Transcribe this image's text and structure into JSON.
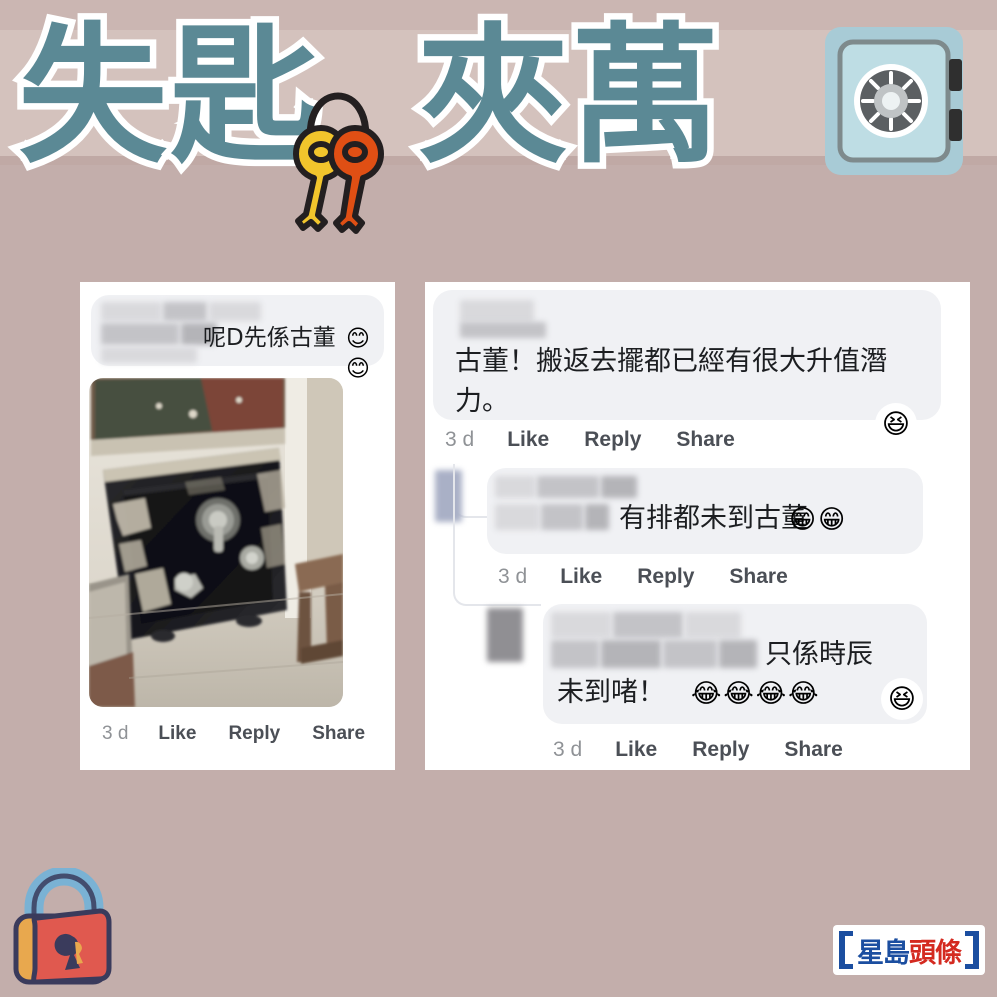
{
  "poster": {
    "headline_text": "失匙夾萬",
    "headline_char_1": "失",
    "headline_char_2": "匙",
    "headline_char_3": "夾",
    "headline_char_4": "萬",
    "headline_color": "#5b8995",
    "headline_outline_color": "#ffffff",
    "background_color": "#c3aeab",
    "wall_color": "#d4c2bd",
    "icons": {
      "keys": "keys-icon",
      "safe": "safe-icon",
      "padlock": "padlock-icon"
    }
  },
  "logo": {
    "name": "sing-tao-headline-logo",
    "text_blue": "星島",
    "text_red": "頭條",
    "blue": "#1b4ea0",
    "red": "#d42a20"
  },
  "screenshot_left": {
    "comment": {
      "text": "呢D先係古董",
      "emojis": "😊😊",
      "author_redacted": true
    },
    "photo_alt": "old black antique safe with peeling paint",
    "actions": {
      "time": "3 d",
      "like": "Like",
      "reply": "Reply",
      "share": "Share"
    }
  },
  "screenshot_right": {
    "comments": [
      {
        "level": 0,
        "text": "古董！搬返去擺都已經有很大升值潛力。",
        "emojis": "",
        "reaction": "😆",
        "author_redacted": true,
        "actions": {
          "time": "3 d",
          "like": "Like",
          "reply": "Reply",
          "share": "Share"
        }
      },
      {
        "level": 1,
        "text": "有排都未到古董",
        "emojis": "😁😁",
        "reaction": "",
        "author_redacted": true,
        "actions": {
          "time": "3 d",
          "like": "Like",
          "reply": "Reply",
          "share": "Share"
        }
      },
      {
        "level": 2,
        "text_line1": "只係時辰",
        "text_line2": "未到啫！",
        "emojis": "😂😂😂😂",
        "reaction": "😆",
        "author_redacted": true,
        "actions": {
          "time": "3 d",
          "like": "Like",
          "reply": "Reply",
          "share": "Share"
        }
      }
    ]
  }
}
